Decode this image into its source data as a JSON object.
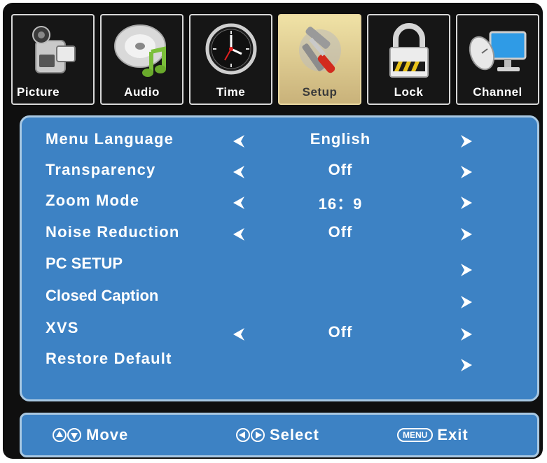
{
  "tabs": [
    {
      "label": "Picture",
      "icon": "camcorder-icon",
      "active": false
    },
    {
      "label": "Audio",
      "icon": "music-disc-icon",
      "active": false
    },
    {
      "label": "Time",
      "icon": "clock-icon",
      "active": false
    },
    {
      "label": "Setup",
      "icon": "tools-icon",
      "active": true
    },
    {
      "label": "Lock",
      "icon": "padlock-icon",
      "active": false
    },
    {
      "label": "Channel",
      "icon": "satellite-monitor-icon",
      "active": false
    }
  ],
  "menu": {
    "items": [
      {
        "label": "Menu Language",
        "value": "English",
        "left_arrow": true,
        "right_arrow": true
      },
      {
        "label": "Transparency",
        "value": "Off",
        "left_arrow": true,
        "right_arrow": true
      },
      {
        "label": "Zoom Mode",
        "value": "16：9",
        "left_arrow": true,
        "right_arrow": true
      },
      {
        "label": "Noise Reduction",
        "value": "Off",
        "left_arrow": true,
        "right_arrow": true
      },
      {
        "label": "PC SETUP",
        "value": "",
        "left_arrow": false,
        "right_arrow": true
      },
      {
        "label": "Closed Caption",
        "value": "",
        "left_arrow": false,
        "right_arrow": true
      },
      {
        "label": "XVS",
        "value": "Off",
        "left_arrow": true,
        "right_arrow": true
      },
      {
        "label": "Restore Default",
        "value": "",
        "left_arrow": false,
        "right_arrow": true
      }
    ]
  },
  "footer": {
    "move_label": "Move",
    "select_label": "Select",
    "menu_key": "MENU",
    "exit_label": "Exit"
  },
  "colors": {
    "panel_blue": "#3d82c4",
    "panel_border": "#a9c8e2",
    "frame_black": "#0f0f0f",
    "active_tab_gold": "#e3cf8f"
  }
}
